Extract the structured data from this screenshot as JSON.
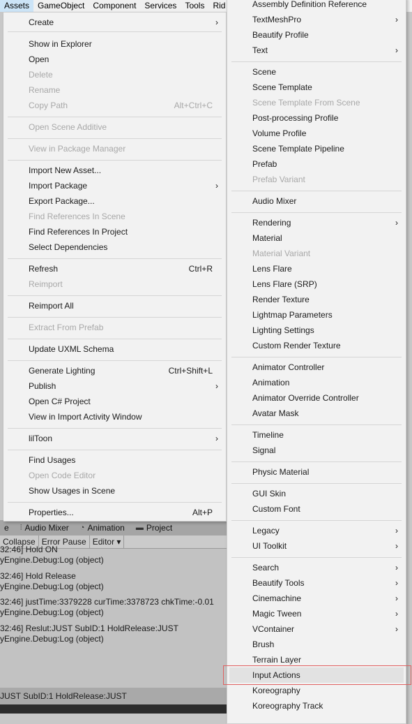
{
  "menubar": {
    "items": [
      "Assets",
      "GameObject",
      "Component",
      "Services",
      "Tools",
      "Rid"
    ]
  },
  "left_menu": {
    "items": [
      {
        "label": "Create",
        "shortcut": "",
        "submenu": true,
        "disabled": false
      },
      {
        "label": "Show in Explorer",
        "shortcut": "",
        "submenu": false,
        "disabled": false
      },
      {
        "label": "Open",
        "shortcut": "",
        "submenu": false,
        "disabled": false
      },
      {
        "label": "Delete",
        "shortcut": "",
        "submenu": false,
        "disabled": true
      },
      {
        "label": "Rename",
        "shortcut": "",
        "submenu": false,
        "disabled": true
      },
      {
        "label": "Copy Path",
        "shortcut": "Alt+Ctrl+C",
        "submenu": false,
        "disabled": true
      },
      {
        "label": "Open Scene Additive",
        "shortcut": "",
        "submenu": false,
        "disabled": true
      },
      {
        "label": "View in Package Manager",
        "shortcut": "",
        "submenu": false,
        "disabled": true
      },
      {
        "label": "Import New Asset...",
        "shortcut": "",
        "submenu": false,
        "disabled": false
      },
      {
        "label": "Import Package",
        "shortcut": "",
        "submenu": true,
        "disabled": false
      },
      {
        "label": "Export Package...",
        "shortcut": "",
        "submenu": false,
        "disabled": false
      },
      {
        "label": "Find References In Scene",
        "shortcut": "",
        "submenu": false,
        "disabled": true
      },
      {
        "label": "Find References In Project",
        "shortcut": "",
        "submenu": false,
        "disabled": false
      },
      {
        "label": "Select Dependencies",
        "shortcut": "",
        "submenu": false,
        "disabled": false
      },
      {
        "label": "Refresh",
        "shortcut": "Ctrl+R",
        "submenu": false,
        "disabled": false
      },
      {
        "label": "Reimport",
        "shortcut": "",
        "submenu": false,
        "disabled": true
      },
      {
        "label": "Reimport All",
        "shortcut": "",
        "submenu": false,
        "disabled": false
      },
      {
        "label": "Extract From Prefab",
        "shortcut": "",
        "submenu": false,
        "disabled": true
      },
      {
        "label": "Update UXML Schema",
        "shortcut": "",
        "submenu": false,
        "disabled": false
      },
      {
        "label": "Generate Lighting",
        "shortcut": "Ctrl+Shift+L",
        "submenu": false,
        "disabled": false
      },
      {
        "label": "Publish",
        "shortcut": "",
        "submenu": true,
        "disabled": false
      },
      {
        "label": "Open C# Project",
        "shortcut": "",
        "submenu": false,
        "disabled": false
      },
      {
        "label": "View in Import Activity Window",
        "shortcut": "",
        "submenu": false,
        "disabled": false
      },
      {
        "label": "lilToon",
        "shortcut": "",
        "submenu": true,
        "disabled": false
      },
      {
        "label": "Find Usages",
        "shortcut": "",
        "submenu": false,
        "disabled": false
      },
      {
        "label": "Open Code Editor",
        "shortcut": "",
        "submenu": false,
        "disabled": true
      },
      {
        "label": "Show Usages in Scene",
        "shortcut": "",
        "submenu": false,
        "disabled": false
      },
      {
        "label": "Properties...",
        "shortcut": "Alt+P",
        "submenu": false,
        "disabled": false
      }
    ]
  },
  "right_menu": {
    "items": [
      {
        "label": "Assembly Definition Reference",
        "submenu": false,
        "disabled": false
      },
      {
        "label": "TextMeshPro",
        "submenu": true,
        "disabled": false
      },
      {
        "label": "Beautify Profile",
        "submenu": false,
        "disabled": false
      },
      {
        "label": "Text",
        "submenu": true,
        "disabled": false
      },
      {
        "label": "Scene",
        "submenu": false,
        "disabled": false
      },
      {
        "label": "Scene Template",
        "submenu": false,
        "disabled": false
      },
      {
        "label": "Scene Template From Scene",
        "submenu": false,
        "disabled": true
      },
      {
        "label": "Post-processing Profile",
        "submenu": false,
        "disabled": false
      },
      {
        "label": "Volume Profile",
        "submenu": false,
        "disabled": false
      },
      {
        "label": "Scene Template Pipeline",
        "submenu": false,
        "disabled": false
      },
      {
        "label": "Prefab",
        "submenu": false,
        "disabled": false
      },
      {
        "label": "Prefab Variant",
        "submenu": false,
        "disabled": true
      },
      {
        "label": "Audio Mixer",
        "submenu": false,
        "disabled": false
      },
      {
        "label": "Rendering",
        "submenu": true,
        "disabled": false
      },
      {
        "label": "Material",
        "submenu": false,
        "disabled": false
      },
      {
        "label": "Material Variant",
        "submenu": false,
        "disabled": true
      },
      {
        "label": "Lens Flare",
        "submenu": false,
        "disabled": false
      },
      {
        "label": "Lens Flare (SRP)",
        "submenu": false,
        "disabled": false
      },
      {
        "label": "Render Texture",
        "submenu": false,
        "disabled": false
      },
      {
        "label": "Lightmap Parameters",
        "submenu": false,
        "disabled": false
      },
      {
        "label": "Lighting Settings",
        "submenu": false,
        "disabled": false
      },
      {
        "label": "Custom Render Texture",
        "submenu": false,
        "disabled": false
      },
      {
        "label": "Animator Controller",
        "submenu": false,
        "disabled": false
      },
      {
        "label": "Animation",
        "submenu": false,
        "disabled": false
      },
      {
        "label": "Animator Override Controller",
        "submenu": false,
        "disabled": false
      },
      {
        "label": "Avatar Mask",
        "submenu": false,
        "disabled": false
      },
      {
        "label": "Timeline",
        "submenu": false,
        "disabled": false
      },
      {
        "label": "Signal",
        "submenu": false,
        "disabled": false
      },
      {
        "label": "Physic Material",
        "submenu": false,
        "disabled": false
      },
      {
        "label": "GUI Skin",
        "submenu": false,
        "disabled": false
      },
      {
        "label": "Custom Font",
        "submenu": false,
        "disabled": false
      },
      {
        "label": "Legacy",
        "submenu": true,
        "disabled": false
      },
      {
        "label": "UI Toolkit",
        "submenu": true,
        "disabled": false
      },
      {
        "label": "Search",
        "submenu": true,
        "disabled": false
      },
      {
        "label": "Beautify Tools",
        "submenu": true,
        "disabled": false
      },
      {
        "label": "Cinemachine",
        "submenu": true,
        "disabled": false
      },
      {
        "label": "Magic Tween",
        "submenu": true,
        "disabled": false
      },
      {
        "label": "VContainer",
        "submenu": true,
        "disabled": false
      },
      {
        "label": "Brush",
        "submenu": false,
        "disabled": false
      },
      {
        "label": "Terrain Layer",
        "submenu": false,
        "disabled": false
      },
      {
        "label": "Input Actions",
        "submenu": false,
        "disabled": false,
        "highlighted": true
      },
      {
        "label": "Koreography",
        "submenu": false,
        "disabled": false
      },
      {
        "label": "Koreography Track",
        "submenu": false,
        "disabled": false
      }
    ]
  },
  "bg": {
    "tabs": [
      {
        "label": "e",
        "icon": ""
      },
      {
        "label": "Audio Mixer",
        "icon": "audio-mixer-icon"
      },
      {
        "label": "Animation",
        "icon": "animation-icon"
      },
      {
        "label": "Project",
        "icon": "folder-icon"
      }
    ],
    "toolbar": [
      "Collapse",
      "Error Pause",
      "Editor"
    ],
    "console_lines": [
      "32:46] Hold ON",
      "yEngine.Debug:Log (object)",
      "32:46] Hold Release",
      "yEngine.Debug:Log (object)",
      "32:46] justTime:3379228 curTime:3378723 chkTime:-0.01",
      "yEngine.Debug:Log (object)",
      "32:46] Reslut:JUST SubID:1 HoldRelease:JUST",
      "yEngine.Debug:Log (object)"
    ],
    "status": "JUST SubID:1 HoldRelease:JUST"
  },
  "colors": {
    "menu_bg": "#f2f2f2",
    "highlight_border": "#e06060",
    "menubar_active": "#cce4f7"
  }
}
